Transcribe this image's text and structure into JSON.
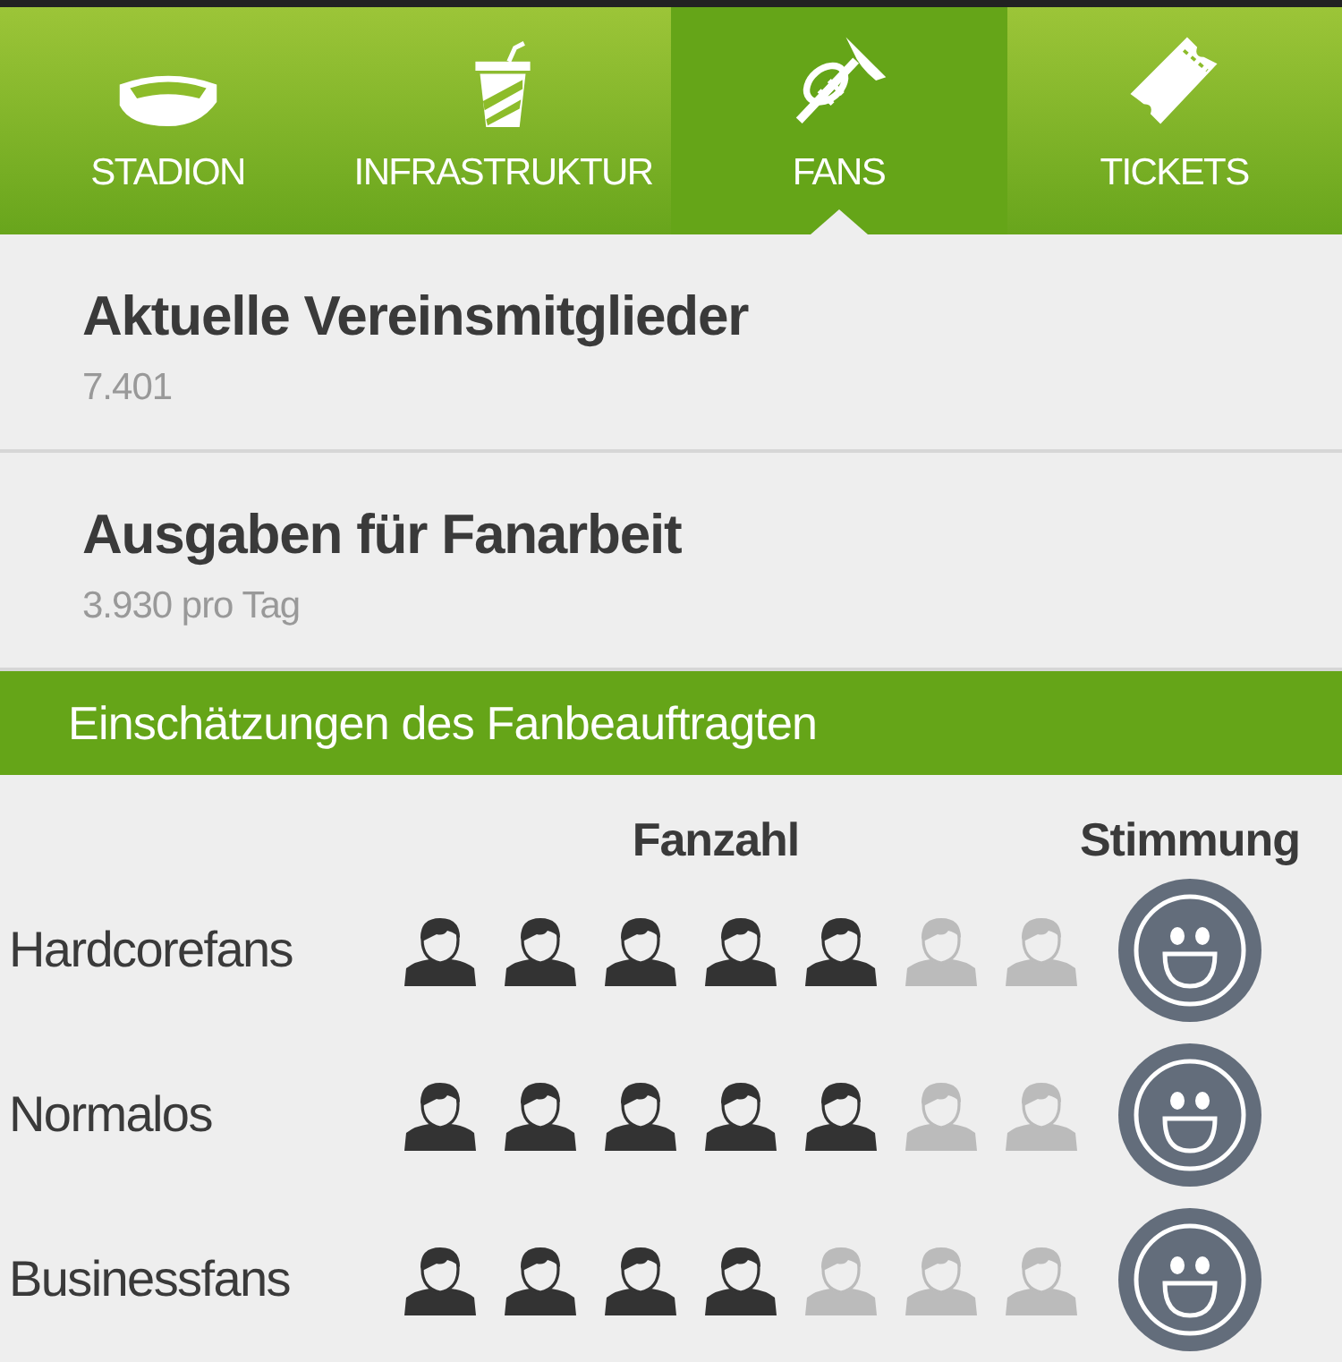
{
  "tabs": [
    {
      "label": "STADION",
      "selected": false
    },
    {
      "label": "INFRASTRUKTUR",
      "selected": false
    },
    {
      "label": "FANS",
      "selected": true
    },
    {
      "label": "TICKETS",
      "selected": false
    }
  ],
  "stats": [
    {
      "title": "Aktuelle Vereinsmitglieder",
      "value": "7.401"
    },
    {
      "title": "Ausgaben für Fanarbeit",
      "value": "3.930 pro Tag"
    }
  ],
  "section": {
    "title": "Einschätzungen des Fanbeauftragten"
  },
  "table": {
    "columns": [
      "Fanzahl",
      "Stimmung"
    ],
    "rows": [
      {
        "label": "Hardcorefans",
        "fans": [
          {
            "filled": true
          },
          {
            "filled": true
          },
          {
            "filled": true
          },
          {
            "filled": true
          },
          {
            "filled": true
          },
          {
            "filled": false
          },
          {
            "filled": false
          }
        ]
      },
      {
        "label": "Normalos",
        "fans": [
          {
            "filled": true
          },
          {
            "filled": true
          },
          {
            "filled": true
          },
          {
            "filled": true
          },
          {
            "filled": true
          },
          {
            "filled": false
          },
          {
            "filled": false
          }
        ]
      },
      {
        "label": "Businessfans",
        "fans": [
          {
            "filled": true
          },
          {
            "filled": true
          },
          {
            "filled": true
          },
          {
            "filled": true
          },
          {
            "filled": false
          },
          {
            "filled": false
          },
          {
            "filled": false
          }
        ]
      }
    ]
  }
}
